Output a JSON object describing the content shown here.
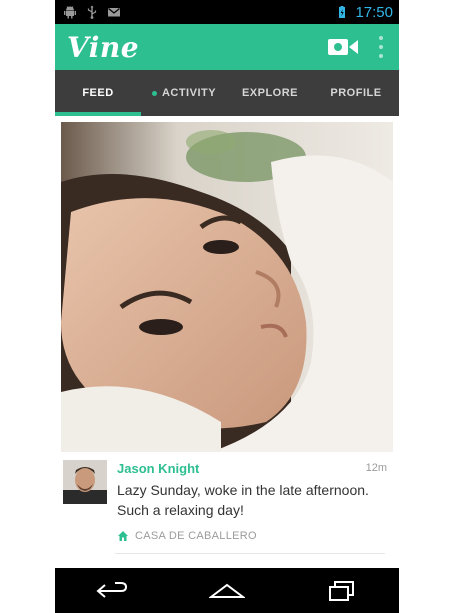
{
  "status_bar": {
    "time": "17:50",
    "icons": [
      "android-icon",
      "usb-icon",
      "mail-icon",
      "battery-icon"
    ]
  },
  "app": {
    "logo": "Vine",
    "actions": [
      "camera-icon",
      "overflow-menu-icon"
    ],
    "accent_color": "#2ebf91"
  },
  "tabs": [
    {
      "label": "FEED",
      "active": true
    },
    {
      "label": "ACTIVITY",
      "active": false,
      "has_dot": true
    },
    {
      "label": "EXPLORE",
      "active": false
    },
    {
      "label": "PROFILE",
      "active": false
    }
  ],
  "post": {
    "username": "Jason Knight",
    "time": "12m",
    "caption": "Lazy Sunday, woke in the late afternoon. Such a relaxing day!",
    "location": "CASA DE CABALLERO"
  },
  "nav": [
    "back-icon",
    "home-icon",
    "recents-icon"
  ]
}
